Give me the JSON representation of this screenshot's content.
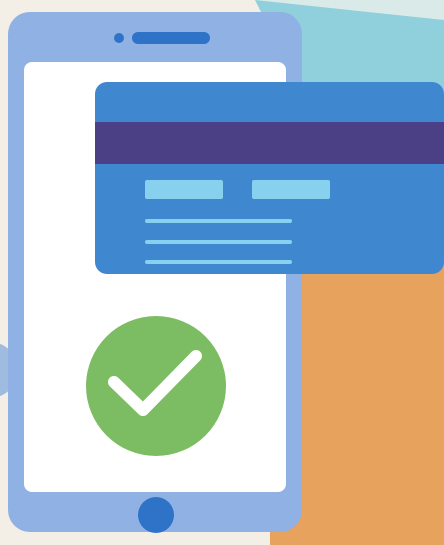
{
  "scene": {
    "description_icons": {
      "phone": "smartphone-icon",
      "card": "credit-card-icon",
      "check": "checkmark-icon",
      "home_button": "home-button-icon",
      "speaker": "speaker-slot-icon"
    },
    "colors": {
      "background": "#f3efe7",
      "orange_panel": "#e7a25d",
      "teal_panel": "#8fd0dc",
      "phone_frame": "#8fb1e3",
      "phone_screen": "#ffffff",
      "card": "#3f88cf",
      "card_stripe": "#4b3f86",
      "card_text_lines": "#87d0ee",
      "check_circle": "#7cbd63",
      "home_button": "#2e73c7",
      "speaker_slot": "#2e73c7"
    }
  }
}
